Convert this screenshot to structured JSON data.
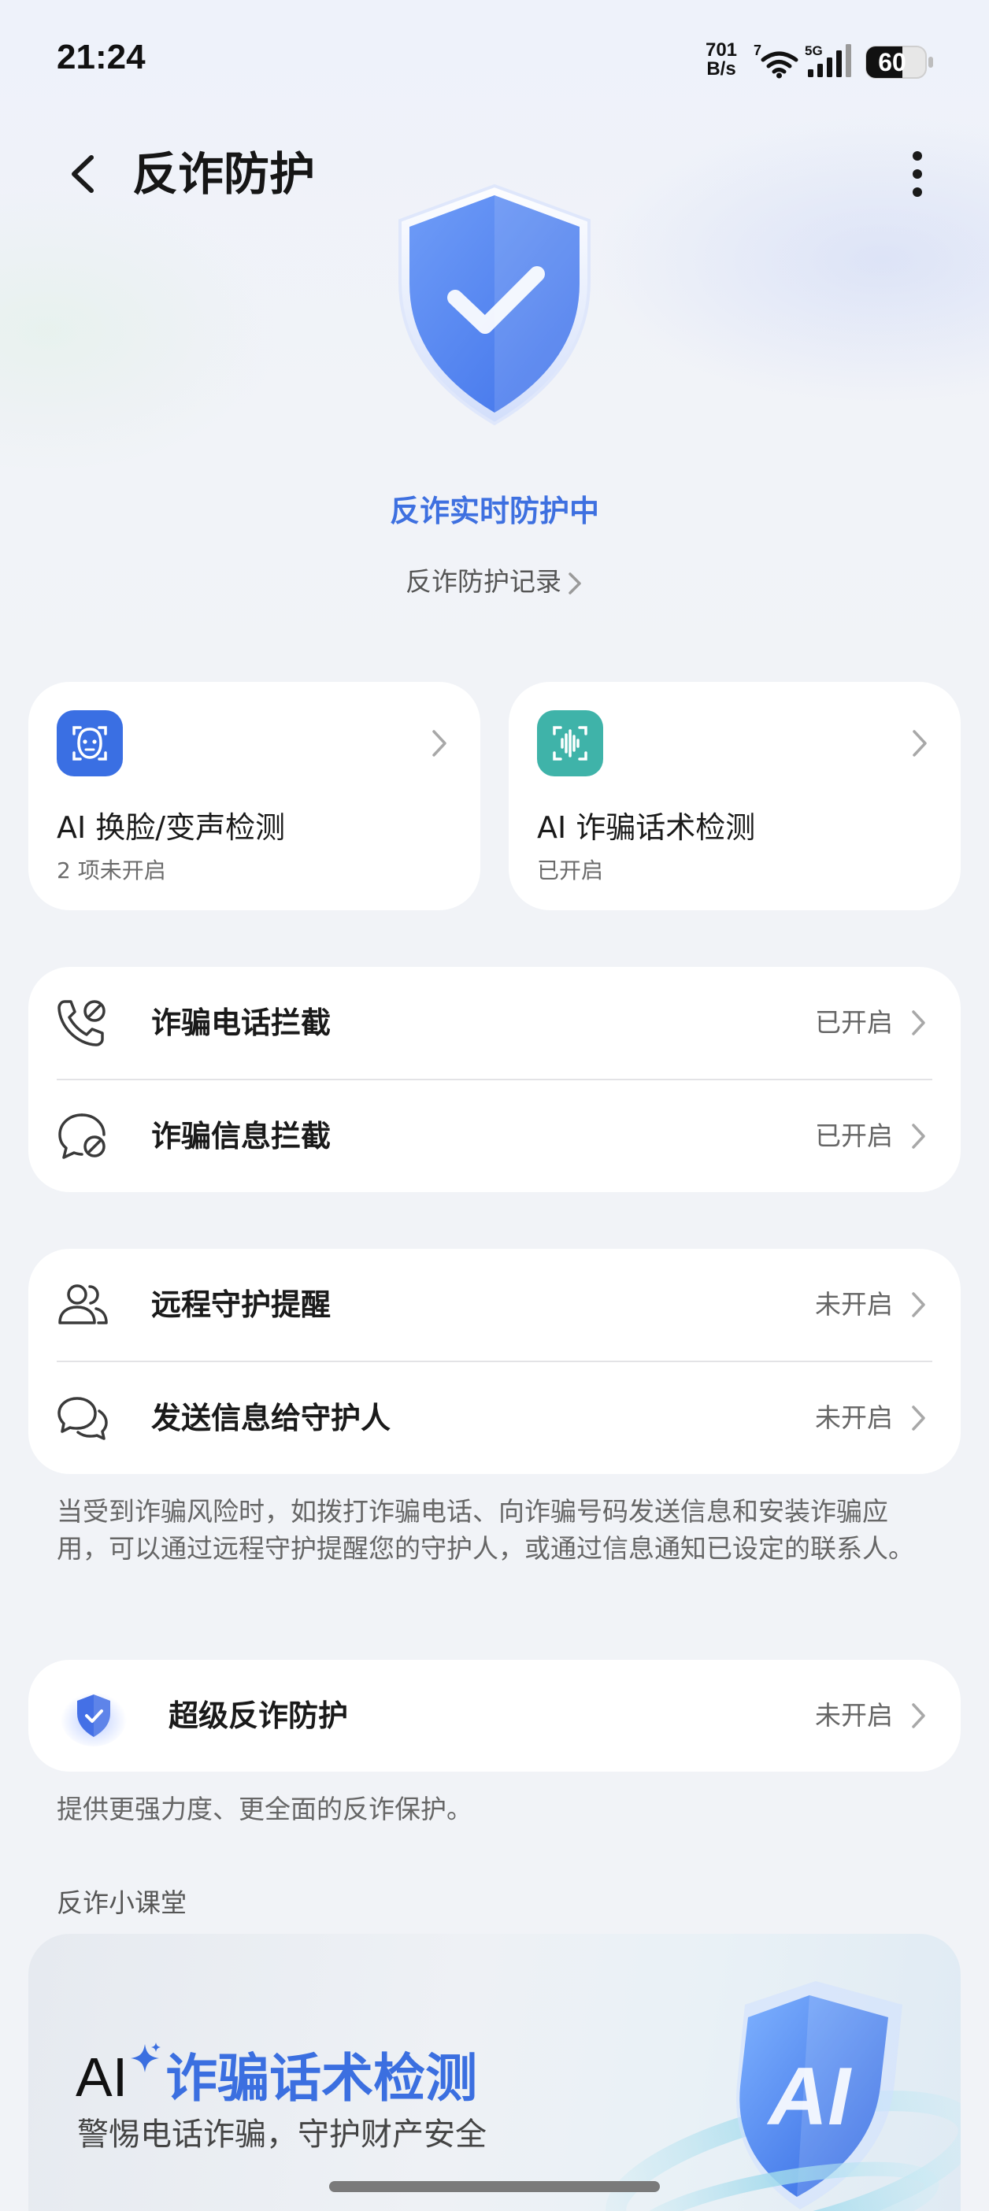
{
  "status_bar": {
    "time": "21:24",
    "net_speed_value": "701",
    "net_speed_unit": "B/s",
    "wifi_badge": "7",
    "signal_badge": "5G",
    "battery": "60"
  },
  "header": {
    "title": "反诈防护"
  },
  "hero": {
    "status": "反诈实时防护中",
    "record_link": "反诈防护记录"
  },
  "feature_cards": [
    {
      "title": "AI 换脸/变声检测",
      "subtitle": "2 项未开启",
      "icon": "face-scan-icon",
      "color": "#3a6fe3"
    },
    {
      "title": "AI 诈骗话术检测",
      "subtitle": "已开启",
      "icon": "voice-scan-icon",
      "color": "#3fb3a9"
    }
  ],
  "intercept_group": [
    {
      "label": "诈骗电话拦截",
      "value": "已开启",
      "icon": "phone-block-icon"
    },
    {
      "label": "诈骗信息拦截",
      "value": "已开启",
      "icon": "message-block-icon"
    }
  ],
  "guardian_group": [
    {
      "label": "远程守护提醒",
      "value": "未开启",
      "icon": "people-icon"
    },
    {
      "label": "发送信息给守护人",
      "value": "未开启",
      "icon": "chat-bubbles-icon"
    }
  ],
  "guardian_description": "当受到诈骗风险时，如拨打诈骗电话、向诈骗号码发送信息和安装诈骗应用，可以通过远程守护提醒您的守护人，或通过信息通知已设定的联系人。",
  "super_protection": {
    "label": "超级反诈防护",
    "value": "未开启",
    "icon": "shield-check-icon",
    "description": "提供更强力度、更全面的反诈保护。"
  },
  "classroom": {
    "section_title": "反诈小课堂",
    "banner_ai": "AI",
    "banner_title": "诈骗话术检测",
    "banner_subtitle": "警惕电话诈骗，守护财产安全",
    "banner_art_text": "AI"
  },
  "colors": {
    "accent": "#3e70e0",
    "teal": "#3fb3a9",
    "background": "#f1f3f7"
  }
}
